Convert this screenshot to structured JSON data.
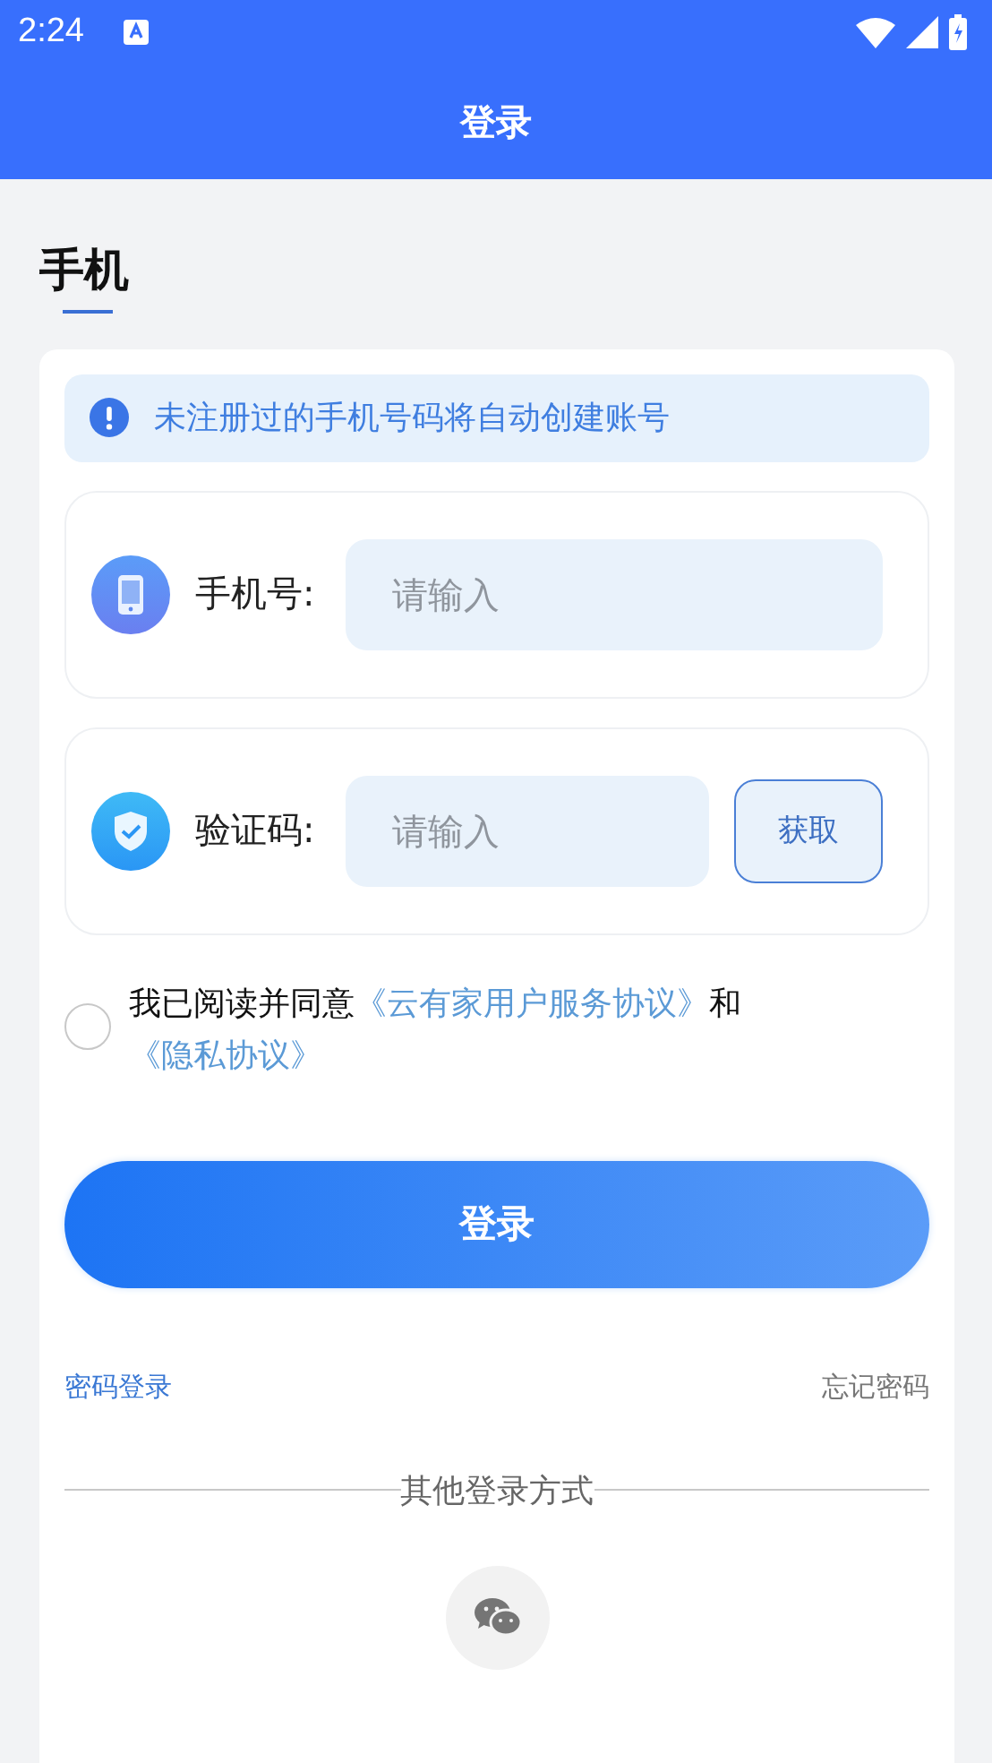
{
  "status_bar": {
    "time": "2:24"
  },
  "header": {
    "title": "登录"
  },
  "section_title": "手机",
  "notice": "未注册过的手机号码将自动创建账号",
  "fields": [
    {
      "kind": "phone",
      "label": "手机号:",
      "placeholder": "请输入"
    },
    {
      "kind": "code",
      "label": "验证码:",
      "placeholder": "请输入",
      "button": "获取"
    }
  ],
  "agreement": {
    "checked": false,
    "text": "我已阅读并同意",
    "link_1": "《云有家用户服务协议》",
    "joiner": "和",
    "link_2": "《隐私协议》"
  },
  "login_button": "登录",
  "password_login": "密码登录",
  "forgot_password": "忘记密码",
  "other_login_title": "其他登录方式"
}
